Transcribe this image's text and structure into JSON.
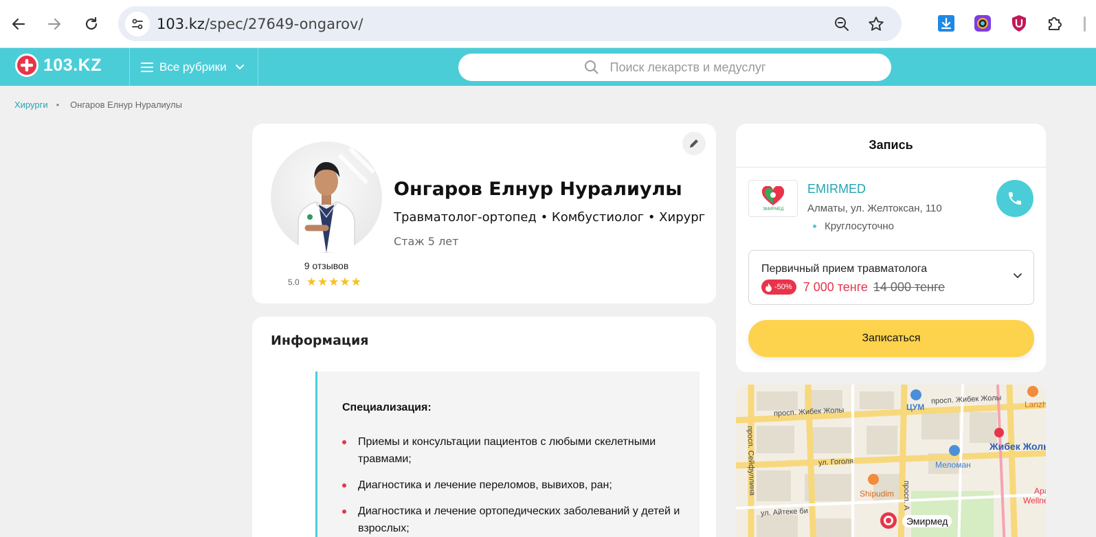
{
  "browser": {
    "url_domain": "103.kz",
    "url_path": "/spec/27649-ongarov/"
  },
  "site": {
    "logo_text": "103.KZ",
    "rubrics_label": "Все рубрики",
    "search_placeholder": "Поиск лекарств и медуслуг"
  },
  "breadcrumb": {
    "items": [
      "Хирурги",
      "Онгаров Елнур Нуралиулы"
    ]
  },
  "doctor": {
    "name": "Онгаров Елнур Нуралиулы",
    "specialties": "Травматолог-ортопед • Комбустиолог • Хирург",
    "experience": "Стаж 5 лет",
    "reviews": "9 отзывов",
    "rating": "5.0",
    "stars": 5
  },
  "info": {
    "title": "Информация",
    "spec_title": "Специализация:",
    "items": [
      "Приемы и консультации пациентов с любыми скелетными травмами;",
      "Диагностика и лечение переломов, вывихов, ран;",
      "Диагностика и лечение ортопедических заболеваний у детей и взрослых;"
    ]
  },
  "booking": {
    "title": "Запись",
    "clinic_name": "EMIRMED",
    "clinic_logo_text": "ЭМИРМЕД",
    "clinic_address": "Алматы, ул. Желтоксан, 110",
    "clinic_hours": "Круглосуточно",
    "service_name": "Первичный прием травматолога",
    "discount": "-50%",
    "price_new": "7 000 тенге",
    "price_old": "14 000 тенге",
    "book_label": "Записаться"
  },
  "map": {
    "labels": {
      "seifullina": "просп. Сейфуллина",
      "zhibek1": "просп. Жибек Жолы",
      "zhibek2": "просп. Жибек Жолы",
      "tsum": "ЦУМ",
      "lanzhou": "Lanzho",
      "zhibek_metro": "Жибек Жолы",
      "gogolya": "ул. Гоголя",
      "meloman": "Меломан",
      "shipudim": "Shipudim",
      "aiteke": "ул. Айтеке би",
      "prosp_a": "просп. А",
      "wellness": "Wellne",
      "ara": "Ара",
      "emirmed": "Эмирмед"
    }
  },
  "colors": {
    "brand_teal": "#4bcdd8",
    "brand_red": "#e8344a",
    "book_yellow": "#fdd24c",
    "link_teal": "#22a5b3"
  }
}
